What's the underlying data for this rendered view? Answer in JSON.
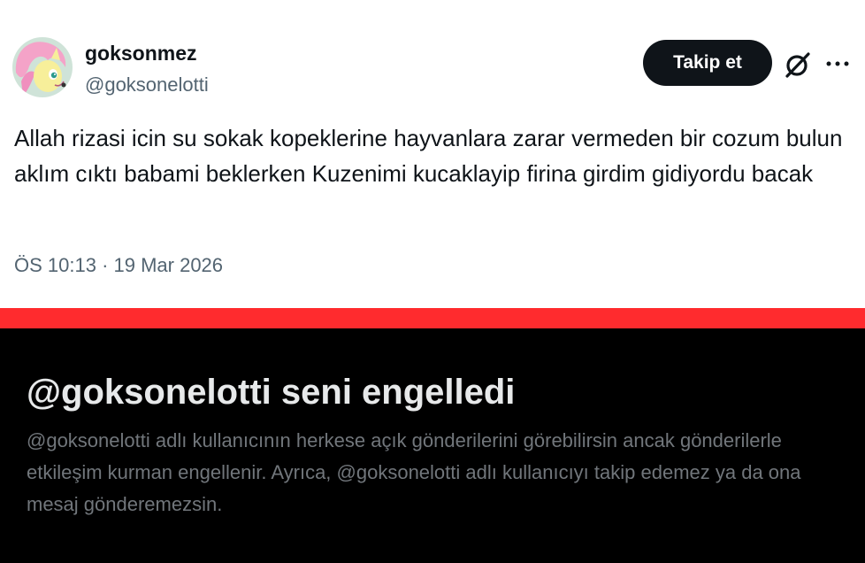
{
  "tweet": {
    "display_name": "goksonmez",
    "handle": "@goksonelotti",
    "follow_label": "Takip et",
    "text": "Allah rizasi icin su sokak kopeklerine hayvanlara zarar vermeden bir cozum bulun aklım cıktı babami beklerken Kuzenimi kucaklayip firina girdim gidiyordu bacak",
    "timestamp": "ÖS 10:13 · 19 Mar 2026"
  },
  "blocked": {
    "title": "@goksonelotti seni engelledi",
    "description": "@goksonelotti adlı kullanıcının herkese açık gönderilerini görebilirsin ancak gönderilerle etkileşim kurman engellenir. Ayrıca, @goksonelotti adlı kullanıcıyı takip edemez ya da ona mesaj gönderemezsin."
  },
  "icons": {
    "avatar": "avatar-pony-image",
    "grok": "grok-slash-circle-icon",
    "more": "more-horizontal-icon"
  },
  "colors": {
    "follow_button_bg": "#0f1419",
    "divider_red": "#ff2b2e",
    "panel_bg": "#000000",
    "secondary_text": "#536471"
  }
}
